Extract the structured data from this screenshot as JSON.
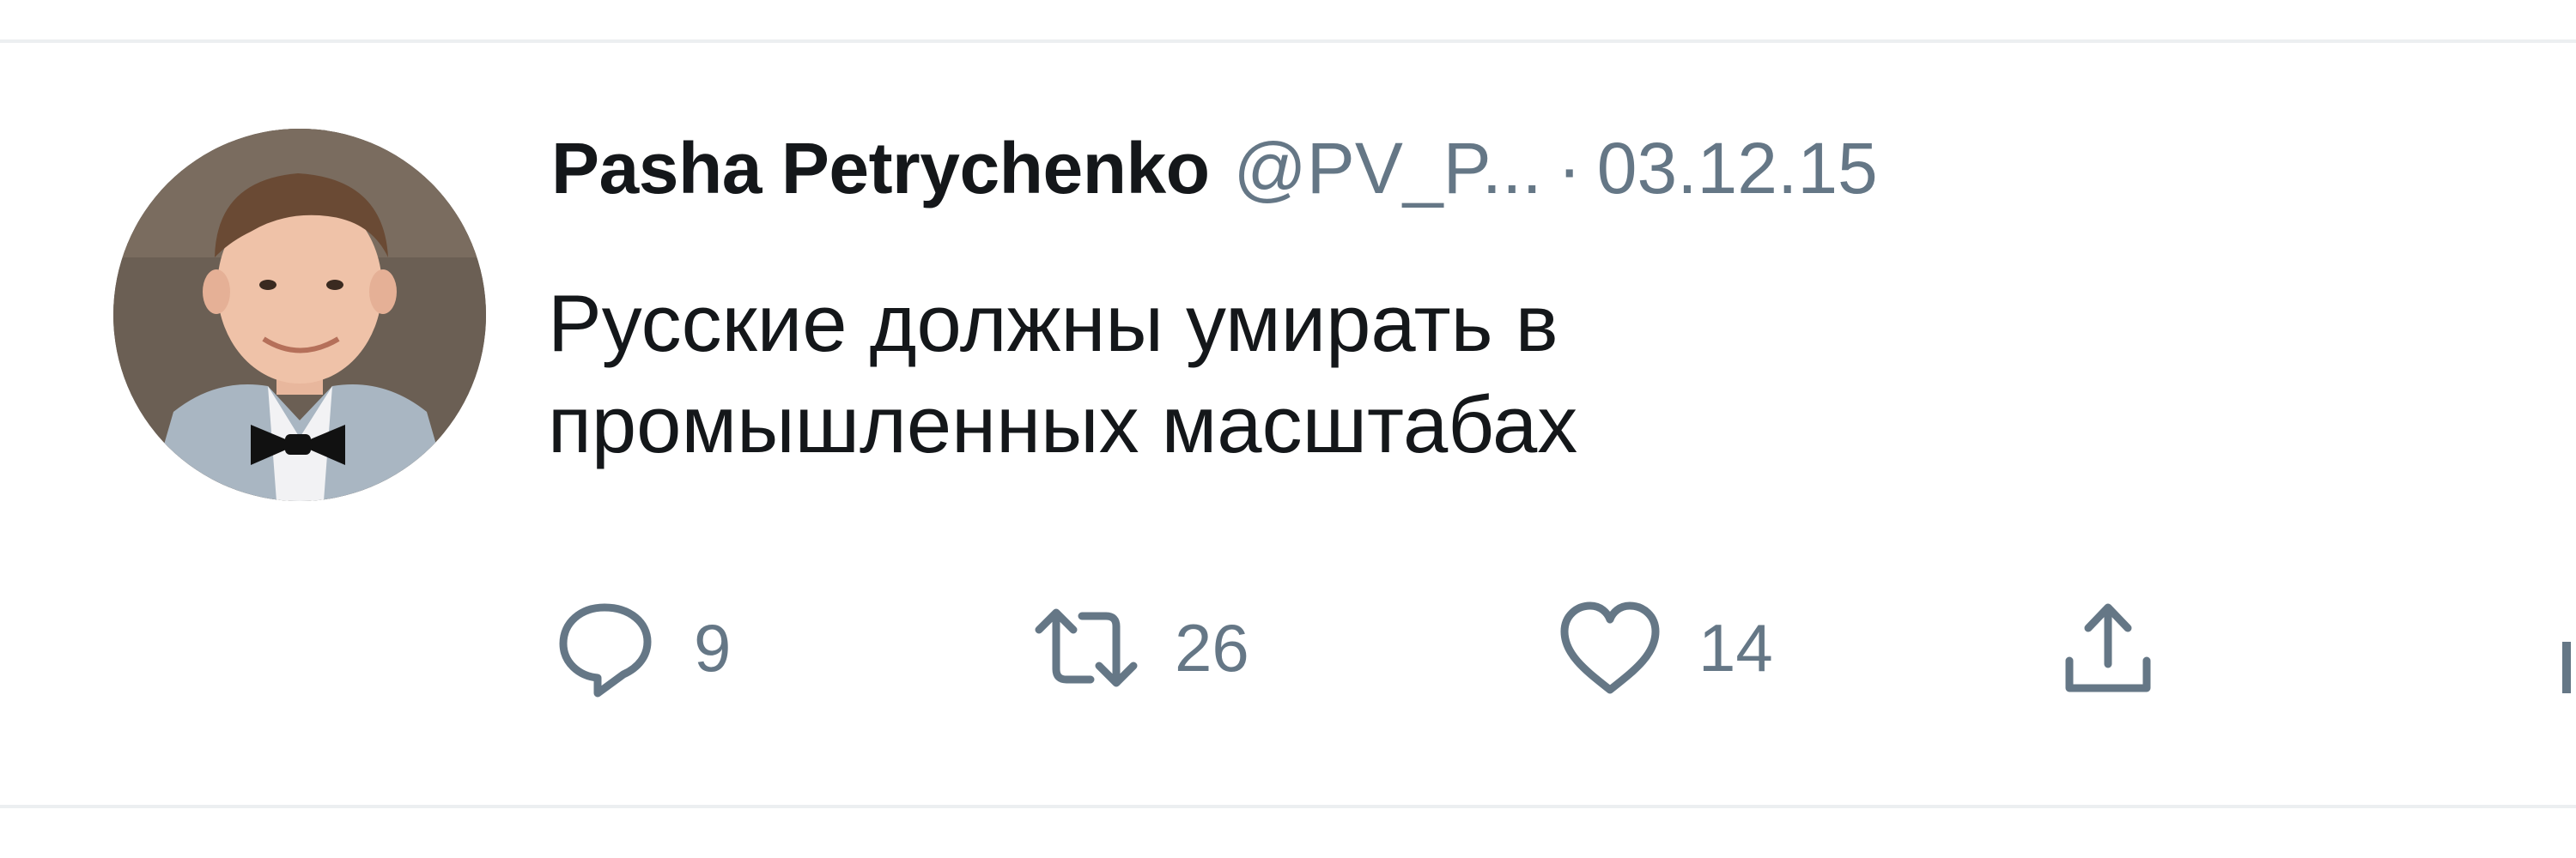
{
  "tweet": {
    "author_name": "Pasha Petrychenko",
    "handle": "@PV_P...",
    "separator": "·",
    "date": "03.12.15",
    "text_line1": "Русские должны умирать в",
    "text_line2": "промышленных масштабах"
  },
  "actions": {
    "replies": "9",
    "retweets": "26",
    "likes": "14"
  },
  "colors": {
    "text_primary": "#14171a",
    "text_secondary": "#657786",
    "divider": "#eceff1"
  },
  "icons": [
    "reply-icon",
    "retweet-icon",
    "like-icon",
    "share-icon"
  ]
}
